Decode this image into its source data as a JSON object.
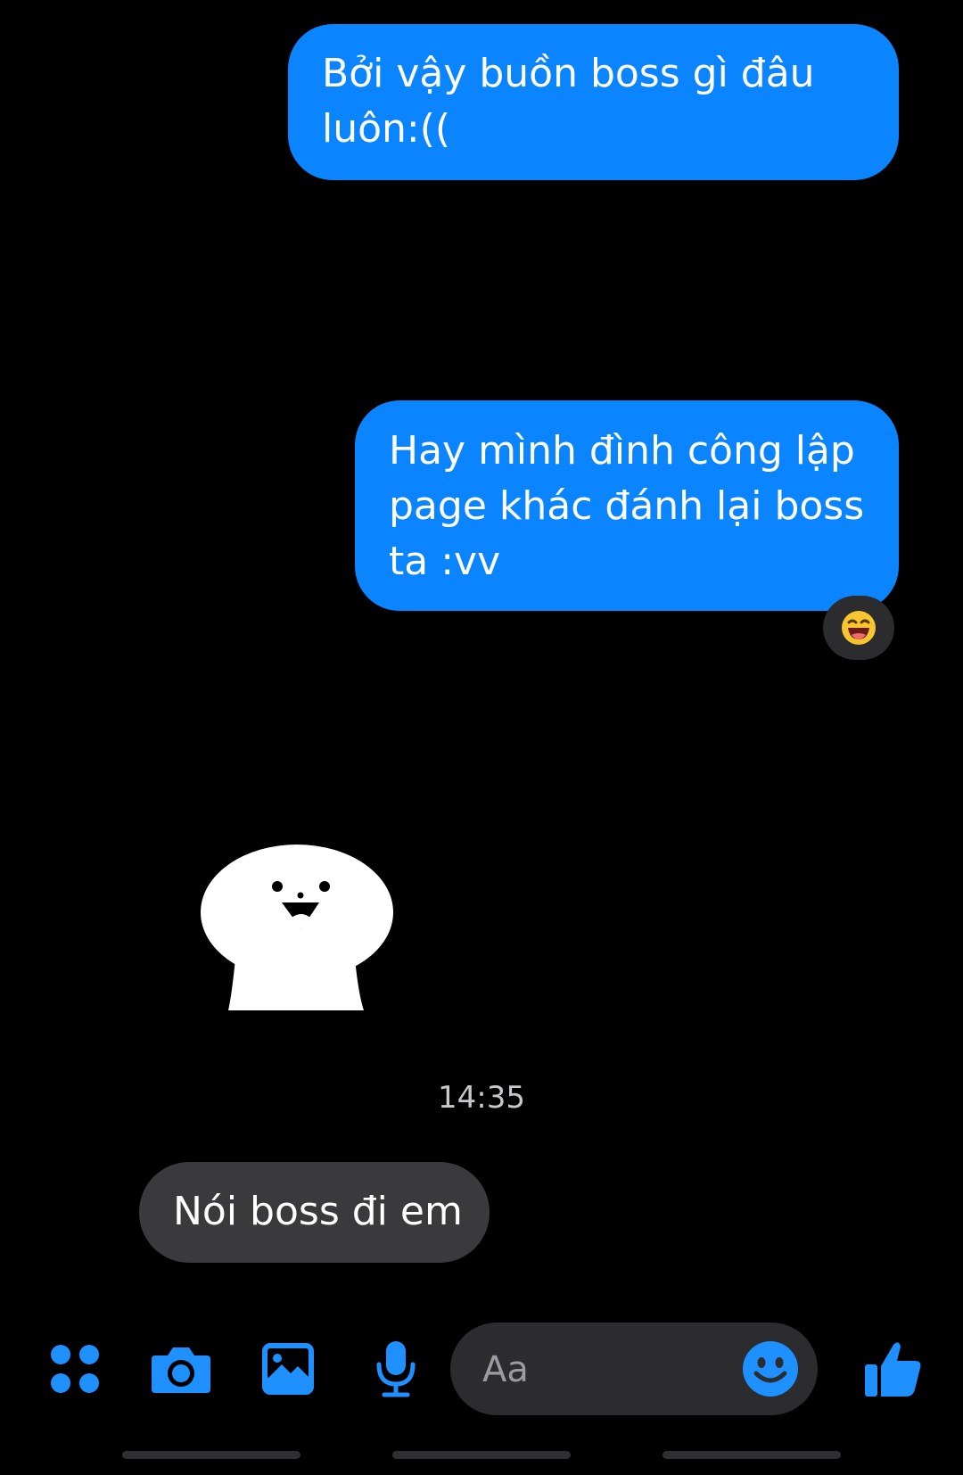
{
  "messages": [
    {
      "direction": "outgoing",
      "text": "Bởi vậy buồn boss gì đâu luôn:(("
    },
    {
      "direction": "outgoing",
      "text": "Hay mình đình công lập page khác đánh lại boss ta :vv",
      "reaction": "laughing-emoji"
    },
    {
      "direction": "incoming",
      "type": "sticker",
      "sticker": "white-blob-smiling"
    },
    {
      "direction": "incoming",
      "text": "Nói boss đi em"
    }
  ],
  "timestamp": "14:35",
  "composer": {
    "placeholder": "Aa",
    "icons": [
      "menu-dots-icon",
      "camera-icon",
      "gallery-icon",
      "microphone-icon",
      "emoji-icon",
      "thumbs-up-icon"
    ]
  },
  "colors": {
    "background": "#000000",
    "outgoing_bubble": "#0a84ff",
    "incoming_bubble": "#3a3a3c",
    "accent": "#1e90ff",
    "input_background": "#2c2c2e"
  }
}
